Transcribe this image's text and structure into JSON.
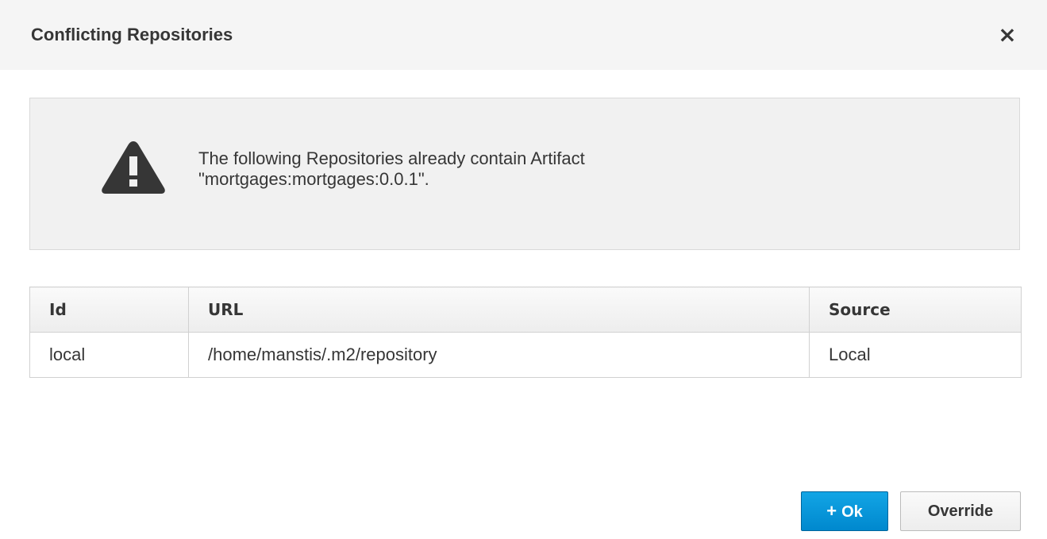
{
  "dialog": {
    "title": "Conflicting Repositories",
    "close_glyph": "×"
  },
  "alert": {
    "icon": "warning-triangle-icon",
    "line1": "The following Repositories already contain Artifact",
    "line2": "\"mortgages:mortgages:0.0.1\"."
  },
  "table": {
    "headers": [
      "Id",
      "URL",
      "Source"
    ],
    "rows": [
      [
        "local",
        "/home/manstis/.m2/repository",
        "Local"
      ]
    ]
  },
  "buttons": {
    "ok_icon": "+",
    "ok_label": "Ok",
    "override_label": "Override"
  },
  "colors": {
    "primary": "#0088ce",
    "header_bg": "#f5f5f5",
    "alert_bg": "#f1f1f1"
  }
}
